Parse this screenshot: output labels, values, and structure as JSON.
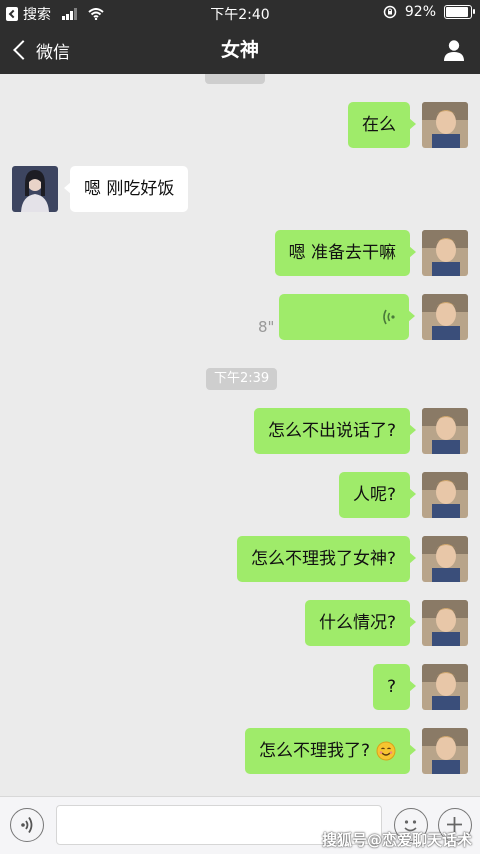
{
  "status_bar": {
    "back_app": "搜索",
    "time": "下午2:40",
    "battery": "92%",
    "battery_level": 0.92
  },
  "nav": {
    "back_label": "微信",
    "title": "女神"
  },
  "chat": {
    "time_stamps": [
      "下午2:39"
    ],
    "messages": [
      {
        "from": "me",
        "text": "在么"
      },
      {
        "from": "other",
        "text": "嗯 刚吃好饭"
      },
      {
        "from": "me",
        "text": "嗯 准备去干嘛"
      },
      {
        "from": "me",
        "type": "voice",
        "duration": "8\""
      },
      {
        "from": "me",
        "text": "怎么不出说话了?"
      },
      {
        "from": "me",
        "text": "人呢?"
      },
      {
        "from": "me",
        "text": "怎么不理我了女神?"
      },
      {
        "from": "me",
        "text": "什么情况?"
      },
      {
        "from": "me",
        "text": "?"
      },
      {
        "from": "me",
        "text": "怎么不理我了?",
        "emoji": "smiling-face-icon"
      }
    ]
  },
  "input_bar": {
    "value": ""
  },
  "watermark": "搜狐号@恋爱聊天话术",
  "colors": {
    "bar_background": "#2e2e2e",
    "chat_background": "#ebebeb",
    "my_bubble": "#9feb6a",
    "other_bubble": "#ffffff",
    "timestamp_chip": "#cecece"
  }
}
